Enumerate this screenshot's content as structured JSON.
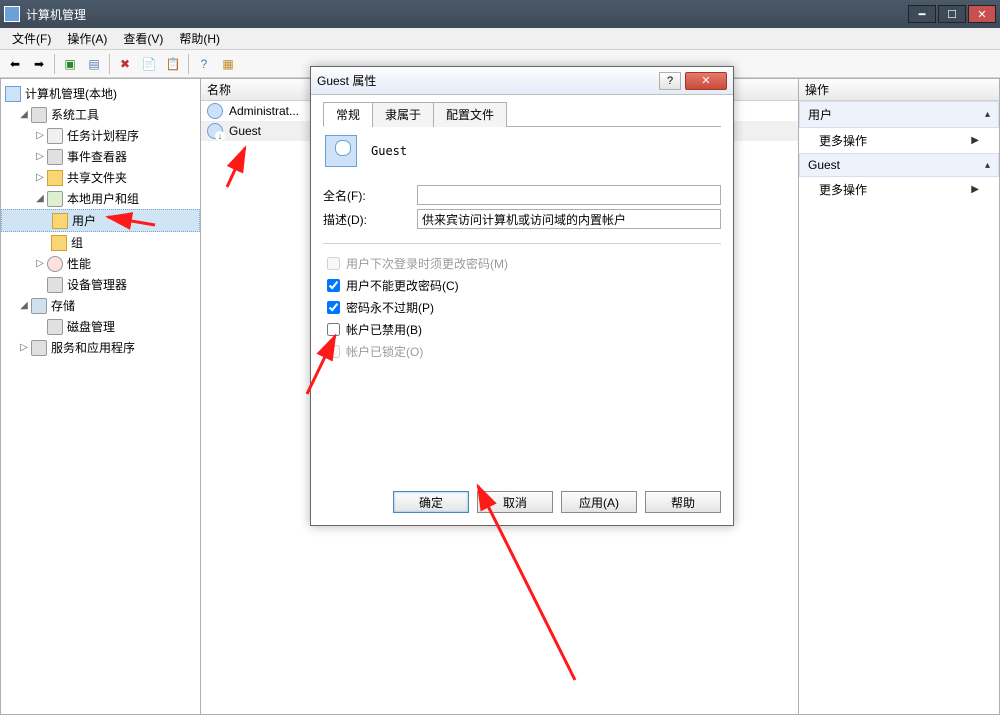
{
  "title": "计算机管理",
  "menu": {
    "file": "文件(F)",
    "action": "操作(A)",
    "view": "查看(V)",
    "help": "帮助(H)"
  },
  "tree": {
    "root": "计算机管理(本地)",
    "systools": "系统工具",
    "tasksched": "任务计划程序",
    "eventvwr": "事件查看器",
    "shared": "共享文件夹",
    "localusers": "本地用户和组",
    "users": "用户",
    "groups": "组",
    "perf": "性能",
    "devmgr": "设备管理器",
    "storage": "存储",
    "diskmgmt": "磁盘管理",
    "services": "服务和应用程序"
  },
  "list": {
    "header": "名称",
    "item0": "Administrat...",
    "item1": "Guest"
  },
  "actions": {
    "header": "操作",
    "section0": "用户",
    "more0": "更多操作",
    "section1": "Guest",
    "more1": "更多操作"
  },
  "dialog": {
    "title": "Guest 属性",
    "tab_general": "常规",
    "tab_memberof": "隶属于",
    "tab_profile": "配置文件",
    "username": "Guest",
    "fullname_label": "全名(F):",
    "fullname_value": "",
    "desc_label": "描述(D):",
    "desc_value": "供来宾访问计算机或访问域的内置帐户",
    "chk_mustchange": "用户下次登录时须更改密码(M)",
    "chk_cannotchange": "用户不能更改密码(C)",
    "chk_neverexpire": "密码永不过期(P)",
    "chk_disabled": "帐户已禁用(B)",
    "chk_locked": "帐户已锁定(O)",
    "btn_ok": "确定",
    "btn_cancel": "取消",
    "btn_apply": "应用(A)",
    "btn_help": "帮助"
  }
}
